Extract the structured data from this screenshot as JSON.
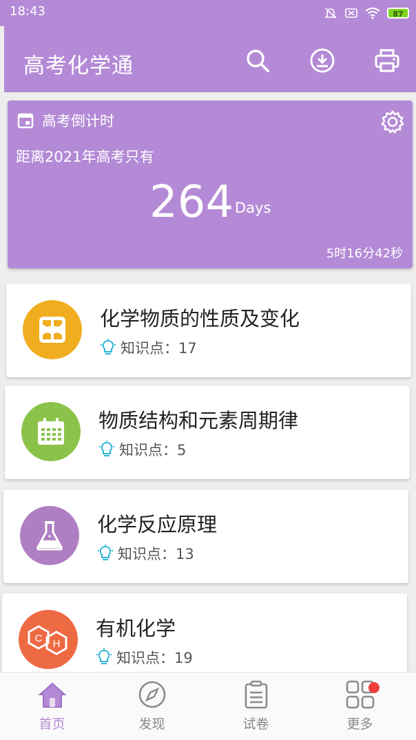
{
  "status_bar": {
    "time": "18:43",
    "battery": "87"
  },
  "app_bar": {
    "title": "高考化学通",
    "actions": [
      "search-icon",
      "download-icon",
      "print-icon"
    ]
  },
  "countdown": {
    "header": "高考倒计时",
    "subtitle": "距离2021年高考只有",
    "days": "264",
    "days_unit": "Days",
    "time_left": "5时16分42秒"
  },
  "topics": [
    {
      "title": "化学物质的性质及变化",
      "meta_label": "知识点：17",
      "icon": "grid-icon",
      "color": "#f0ad1f"
    },
    {
      "title": "物质结构和元素周期律",
      "meta_label": "知识点：5",
      "icon": "calendar-icon",
      "color": "#8bc34a"
    },
    {
      "title": "化学反应原理",
      "meta_label": "知识点：13",
      "icon": "flask-icon",
      "color": "#b07fc3"
    },
    {
      "title": "有机化学",
      "meta_label": "知识点：19",
      "icon": "hexagon-ch-icon",
      "color": "#ee6a43",
      "icon_letters": [
        "C",
        "H"
      ]
    }
  ],
  "tabs": [
    {
      "label": "首页",
      "icon": "home-icon",
      "active": true
    },
    {
      "label": "发现",
      "icon": "compass-icon",
      "active": false
    },
    {
      "label": "试卷",
      "icon": "paper-icon",
      "active": false
    },
    {
      "label": "更多",
      "icon": "apps-icon",
      "active": false,
      "badge": true
    }
  ],
  "colors": {
    "primary": "#b48ad6",
    "accent_icon": "#2bb6d6",
    "badge": "#f03e3e"
  }
}
